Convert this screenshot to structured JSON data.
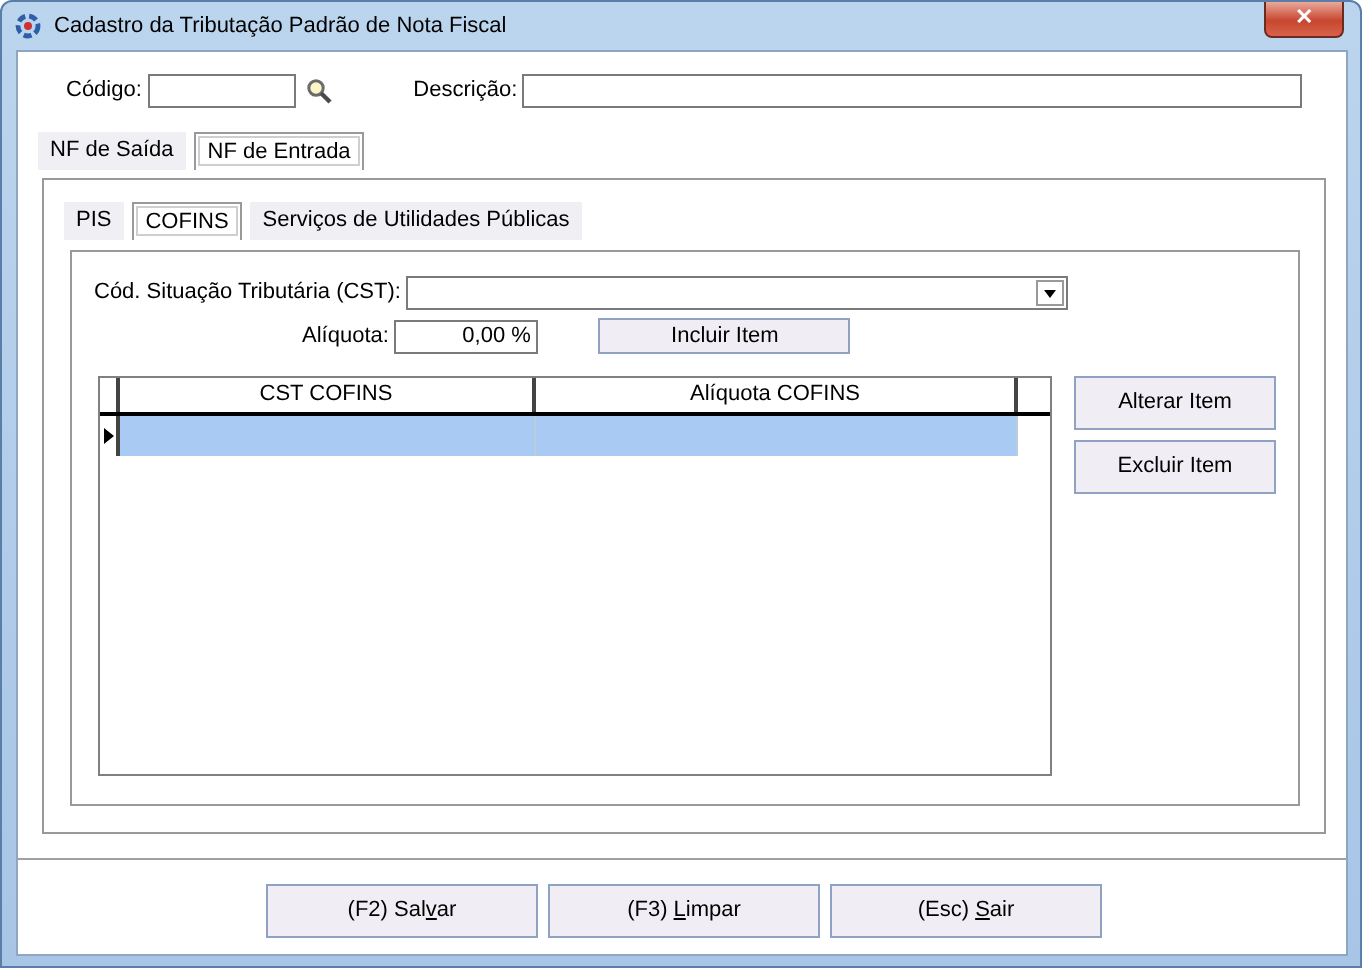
{
  "window": {
    "title": "Cadastro da Tributação Padrão de Nota Fiscal",
    "close": "✕"
  },
  "header": {
    "code_label": "Código:",
    "description_label": "Descrição:"
  },
  "tabs": [
    {
      "label": "NF de Saída",
      "selected": false
    },
    {
      "label": "NF de Entrada",
      "selected": true
    }
  ],
  "subtabs": [
    {
      "label": "PIS",
      "selected": false
    },
    {
      "label": "COFINS",
      "selected": true
    },
    {
      "label": "Serviços de Utilidades Públicas",
      "selected": false
    }
  ],
  "form": {
    "cst_label": "Cód. Situação Tributária (CST):",
    "rate_label": "Alíquota:",
    "rate_value": "0,00 %",
    "add_button": "Incluir Item"
  },
  "grid": {
    "columns": [
      "CST COFINS",
      "Alíquota COFINS"
    ],
    "rows": [
      {
        "selected": true
      }
    ]
  },
  "side_buttons": [
    "Alterar Item",
    "Excluir Item"
  ],
  "buttons": [
    {
      "parts": [
        "(F2) Sal",
        "v",
        "ar"
      ]
    },
    {
      "parts": [
        "(F3) ",
        "L",
        "impar"
      ]
    },
    {
      "parts": [
        "(Esc) ",
        "S",
        "air"
      ]
    }
  ]
}
